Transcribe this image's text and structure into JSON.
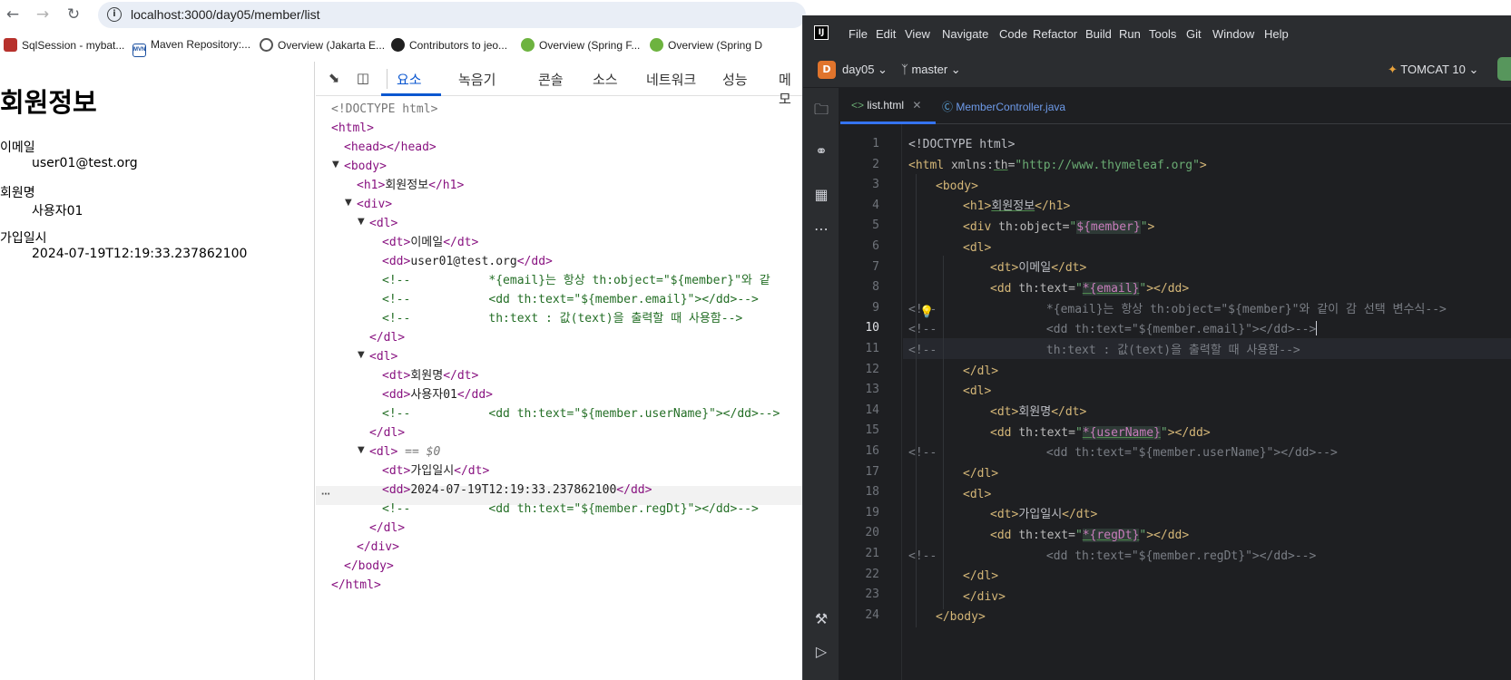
{
  "browser": {
    "url": "localhost:3000/day05/member/list",
    "bookmarks": [
      {
        "label": "SqlSession - mybat...",
        "icon": "mybatis-icon"
      },
      {
        "label": "Maven Repository:...",
        "icon": "maven-icon"
      },
      {
        "label": "Overview (Jakarta E...",
        "icon": "jakarta-icon"
      },
      {
        "label": "Contributors to jeo...",
        "icon": "github-icon"
      },
      {
        "label": "Overview (Spring F...",
        "icon": "spring-icon"
      },
      {
        "label": "Overview (Spring D",
        "icon": "spring-icon"
      }
    ]
  },
  "page": {
    "title": "회원정보",
    "fields": [
      {
        "label": "이메일",
        "value": "user01@test.org"
      },
      {
        "label": "회원명",
        "value": "사용자01"
      },
      {
        "label": "가입일시",
        "value": "2024-07-19T12:19:33.237862100"
      }
    ]
  },
  "devtools": {
    "tabs": [
      "요소",
      "녹음기",
      "콘솔",
      "소스",
      "네트워크",
      "성능",
      "메모"
    ],
    "active_tab": "요소",
    "dom": {
      "doctype": "<!DOCTYPE html>",
      "html_open": "<html>",
      "head": "<head></head>",
      "body_open": "<body>",
      "h1_open": "<h1>",
      "h1_text": "회원정보",
      "h1_close": "</h1>",
      "div_open": "<div>",
      "dl_open": "<dl>",
      "dt_open": "<dt>",
      "dt_close": "</dt>",
      "dd_open": "<dd>",
      "dd_close": "</dd>",
      "dl_close": "</dl>",
      "div_close": "</div>",
      "body_close": "</body>",
      "html_close": "</html>",
      "email_label": "이메일",
      "email_value": "user01@test.org",
      "c1": "<!--           *{email}는 항상 th:object=\"${member}\"와 같",
      "c2": "<!--           <dd th:text=\"${member.email}\"></dd>-->",
      "c3": "<!--           th:text : 값(text)을 출력할 때 사용함-->",
      "name_label": "회원명",
      "name_value": "사용자01",
      "c4": "<!--           <dd th:text=\"${member.userName}\"></dd>-->",
      "selected_marker": "== $0",
      "date_label": "가입일시",
      "date_value": "2024-07-19T12:19:33.237862100",
      "c5": "<!--           <dd th:text=\"${member.regDt}\"></dd>-->"
    }
  },
  "ide": {
    "menu": [
      "File",
      "Edit",
      "View",
      "Navigate",
      "Code",
      "Refactor",
      "Build",
      "Run",
      "Tools",
      "Git",
      "Window",
      "Help"
    ],
    "project": "day05",
    "project_badge": "D",
    "branch": "master",
    "run_config": "TOMCAT 10",
    "tabs": [
      {
        "label": "list.html",
        "active": true
      },
      {
        "label": "MemberController.java",
        "active": false
      }
    ],
    "current_line": 10,
    "line_numbers": [
      "1",
      "2",
      "3",
      "4",
      "5",
      "6",
      "7",
      "8",
      "9",
      "10",
      "11",
      "12",
      "13",
      "14",
      "15",
      "16",
      "17",
      "18",
      "19",
      "20",
      "21",
      "22",
      "23",
      "24"
    ],
    "code": {
      "l1": "<!DOCTYPE html>",
      "l2_tag": "<html",
      "l2_attr": " xmlns:",
      "l2_ns": "th",
      "l2_eq": "=",
      "l2_str": "\"http://www.thymeleaf.org\"",
      "l2_end": ">",
      "l3": "<body>",
      "l4_open": "<h1>",
      "l4_text": "회원정보",
      "l4_close": "</h1>",
      "l5_open": "<div ",
      "l5_attr": "th:object=",
      "l5_q1": "\"",
      "l5_expr": "${member}",
      "l5_q2": "\"",
      "l5_end": ">",
      "l6": "<dl>",
      "l7_open": "<dt>",
      "l7_text": "이메일",
      "l7_close": "</dt>",
      "l8_open": "<dd ",
      "l8_attr": "th:text=",
      "l8_q1": "\"",
      "l8_expr": "*{email}",
      "l8_q2": "\"",
      "l8_end": "></dd>",
      "l9_a": "<!--",
      "l9_b": "        *{email}는 항상 th:object=\"${member}\"와 같이 감 선택 변수식-->",
      "l10_a": "<!--",
      "l10_b": "        <dd th:text=\"${member.email}\"></dd>-->",
      "l11_a": "<!--",
      "l11_b": "        th:text : 값(text)을 출력할 때 사용함-->",
      "l12": "</dl>",
      "l13": "<dl>",
      "l14_open": "<dt>",
      "l14_text": "회원명",
      "l14_close": "</dt>",
      "l15_open": "<dd ",
      "l15_attr": "th:text=",
      "l15_q1": "\"",
      "l15_expr": "*{userName}",
      "l15_q2": "\"",
      "l15_end": "></dd>",
      "l16_a": "<!--",
      "l16_b": "        <dd th:text=\"${member.userName}\"></dd>-->",
      "l17": "</dl>",
      "l18": "<dl>",
      "l19_open": "<dt>",
      "l19_text": "가입일시",
      "l19_close": "</dt>",
      "l20_open": "<dd ",
      "l20_attr": "th:text=",
      "l20_q1": "\"",
      "l20_expr": "*{regDt}",
      "l20_q2": "\"",
      "l20_end": "></dd>",
      "l21_a": "<!--",
      "l21_b": "        <dd th:text=\"${member.regDt}\"></dd>-->",
      "l22": "</dl>",
      "l23": "</div>",
      "l24": "</body>"
    }
  }
}
